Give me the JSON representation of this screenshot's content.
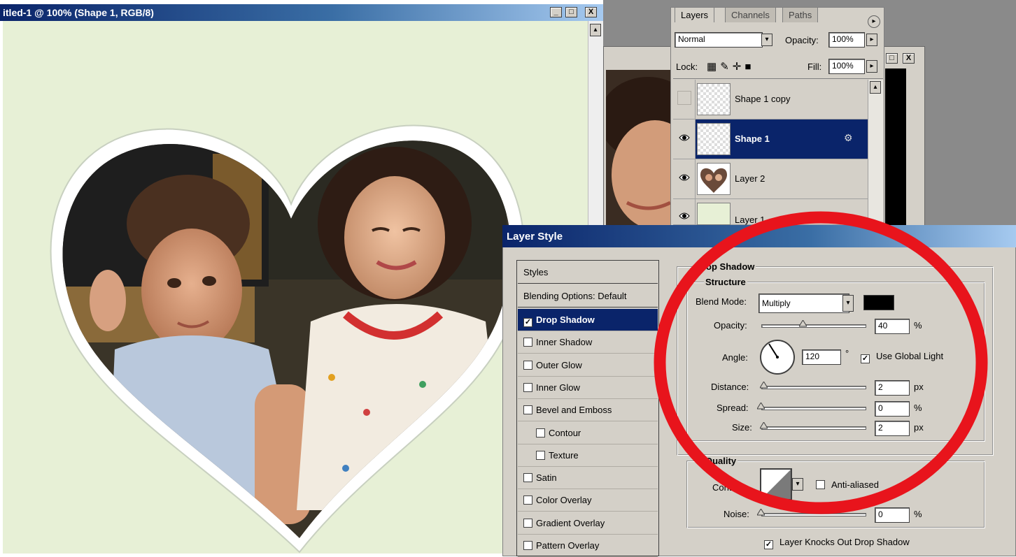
{
  "document": {
    "title": "itled-1 @ 100% (Shape 1, RGB/8)",
    "canvas_color": "#e7f0d6",
    "window_buttons": [
      "_",
      "□",
      "X"
    ]
  },
  "layers_panel": {
    "tabs": [
      "Layers",
      "Channels",
      "Paths"
    ],
    "blend_mode": "Normal",
    "opacity_label": "Opacity:",
    "opacity_value": "100%",
    "lock_label": "Lock:",
    "fill_label": "Fill:",
    "fill_value": "100%",
    "layers": [
      {
        "name": "Shape 1 copy",
        "visible": false,
        "selected": false
      },
      {
        "name": "Shape 1",
        "visible": true,
        "selected": true
      },
      {
        "name": "Layer 2",
        "visible": true,
        "selected": false
      },
      {
        "name": "Layer 1",
        "visible": true,
        "selected": false
      }
    ]
  },
  "layer_style": {
    "title": "Layer Style",
    "styles_header": "Styles",
    "blending_options": "Blending Options: Default",
    "style_items": [
      {
        "label": "Drop Shadow",
        "checked": true,
        "selected": true,
        "indent": false
      },
      {
        "label": "Inner Shadow",
        "checked": false,
        "selected": false,
        "indent": false
      },
      {
        "label": "Outer Glow",
        "checked": false,
        "selected": false,
        "indent": false
      },
      {
        "label": "Inner Glow",
        "checked": false,
        "selected": false,
        "indent": false
      },
      {
        "label": "Bevel and Emboss",
        "checked": false,
        "selected": false,
        "indent": false
      },
      {
        "label": "Contour",
        "checked": false,
        "selected": false,
        "indent": true
      },
      {
        "label": "Texture",
        "checked": false,
        "selected": false,
        "indent": true
      },
      {
        "label": "Satin",
        "checked": false,
        "selected": false,
        "indent": false
      },
      {
        "label": "Color Overlay",
        "checked": false,
        "selected": false,
        "indent": false
      },
      {
        "label": "Gradient Overlay",
        "checked": false,
        "selected": false,
        "indent": false
      },
      {
        "label": "Pattern Overlay",
        "checked": false,
        "selected": false,
        "indent": false
      }
    ],
    "drop_shadow": {
      "section_title": "rop Shadow",
      "structure_title": "Structure",
      "blend_mode_label": "Blend Mode:",
      "blend_mode_value": "Multiply",
      "shadow_color": "#000000",
      "opacity_label": "Opacity:",
      "opacity_value": "40",
      "opacity_unit": "%",
      "angle_label": "Angle:",
      "angle_value": "120",
      "angle_unit": "°",
      "use_global_light_label": "Use Global Light",
      "use_global_light": true,
      "distance_label": "Distance:",
      "distance_value": "2",
      "distance_unit": "px",
      "spread_label": "Spread:",
      "spread_value": "0",
      "spread_unit": "%",
      "size_label": "Size:",
      "size_value": "2",
      "size_unit": "px",
      "quality_title": "Quality",
      "contour_label": "Contour:",
      "anti_aliased_label": "Anti-aliased",
      "anti_aliased": false,
      "noise_label": "Noise:",
      "noise_value": "0",
      "noise_unit": "%",
      "knockout_label": "Layer Knocks Out Drop Shadow",
      "knockout": true
    }
  },
  "annotation_color": "#e8141c"
}
